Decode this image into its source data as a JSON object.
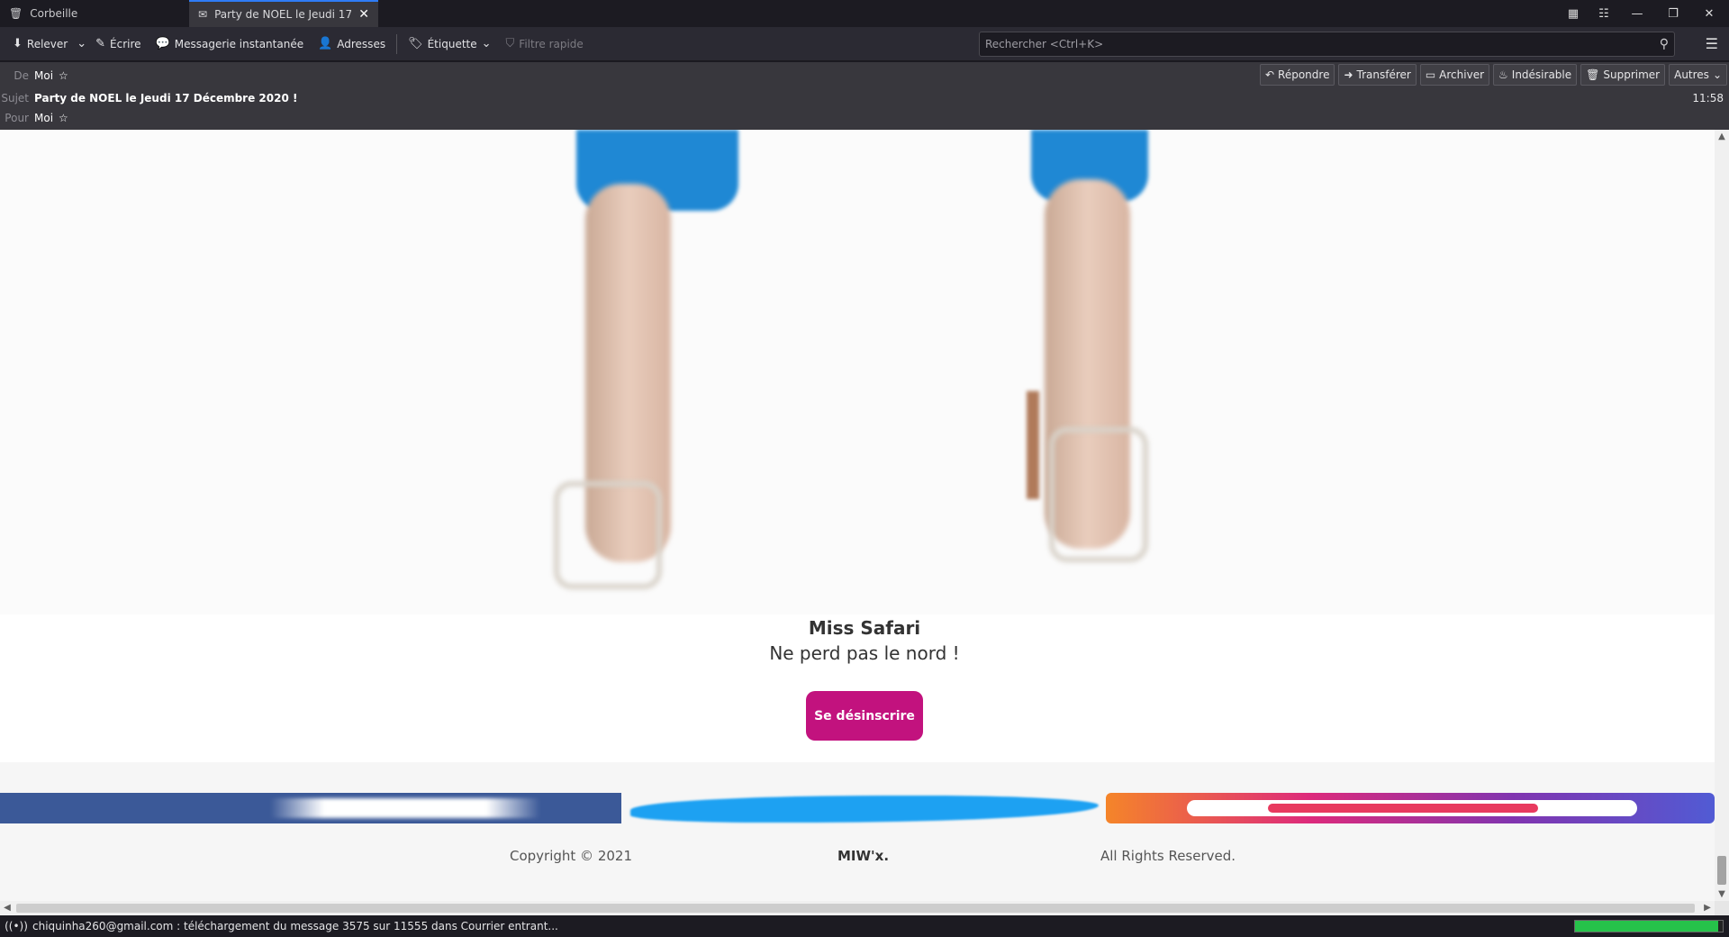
{
  "tabs": [
    {
      "label": "Corbeille",
      "icon": "trash-icon",
      "active": false
    },
    {
      "label": "Party de NOEL le Jeudi 17 Décembre 2020 !",
      "icon": "envelope-icon",
      "active": true
    }
  ],
  "toolbar": {
    "get_messages": "Relever",
    "write": "Écrire",
    "chat": "Messagerie instantanée",
    "address_book": "Adresses",
    "tag": "Étiquette",
    "quick_filter": "Filtre rapide",
    "search_placeholder": "Rechercher <Ctrl+K>"
  },
  "header": {
    "from_label": "De",
    "from_value": "Moi",
    "subject_label": "Sujet",
    "subject_value": "Party de NOEL le Jeudi 17 Décembre 2020 !",
    "to_label": "Pour",
    "to_value": "Moi",
    "time": "11:58",
    "buttons": {
      "reply": "Répondre",
      "forward": "Transférer",
      "archive": "Archiver",
      "junk": "Indésirable",
      "delete": "Supprimer",
      "more": "Autres"
    }
  },
  "email": {
    "brand_title": "Miss Safari",
    "tagline": "Ne perd pas le nord !",
    "unsubscribe": "Se désinscrire",
    "copyright": "Copyright © 2021",
    "company": "MIW'x.",
    "rights": "All Rights Reserved."
  },
  "status": {
    "message": "chiquinha260@gmail.com : téléchargement du message 3575 sur 11555 dans Courrier entrant...",
    "progress": 0.97
  },
  "colors": {
    "accent": "#2f7cf6",
    "unsubscribe_button": "#c2127e",
    "facebook": "#3b5998",
    "twitter": "#1da1f2",
    "progress": "#26c24a"
  }
}
